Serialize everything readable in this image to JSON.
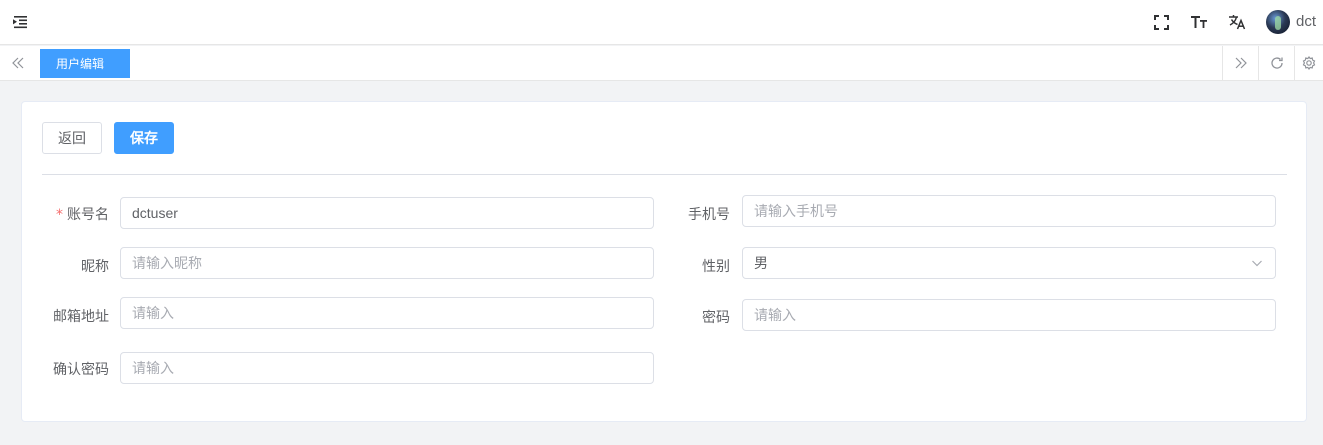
{
  "header": {
    "username": "dct",
    "icons": {
      "menu": "indent-menu-icon",
      "fullscreen": "fullscreen-icon",
      "font_size": "font-size-icon",
      "language": "translate-icon",
      "avatar": "avatar"
    }
  },
  "tags": {
    "active_tag": "用户编辑"
  },
  "toolbar": {
    "back_label": "返回",
    "save_label": "保存"
  },
  "form": {
    "account": {
      "label": "账号名",
      "required_mark": "*",
      "value": "dctuser"
    },
    "phone": {
      "label": "手机号",
      "placeholder": "请输入手机号",
      "value": ""
    },
    "nickname": {
      "label": "昵称",
      "placeholder": "请输入昵称",
      "value": ""
    },
    "gender": {
      "label": "性别",
      "value": "男"
    },
    "email": {
      "label": "邮箱地址",
      "placeholder": "请输入",
      "value": ""
    },
    "password": {
      "label": "密码",
      "placeholder": "请输入",
      "value": ""
    },
    "confirm_password": {
      "label": "确认密码",
      "placeholder": "请输入",
      "value": ""
    }
  },
  "colors": {
    "primary": "#409eff",
    "required": "#f56c6c",
    "border": "#dcdfe6",
    "background": "#f2f3f5"
  }
}
